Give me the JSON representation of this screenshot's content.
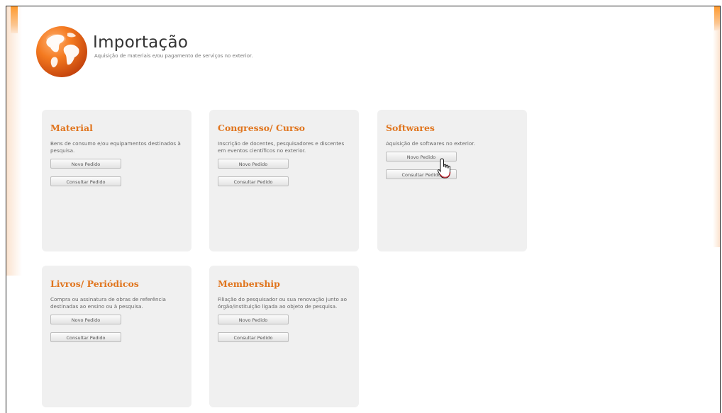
{
  "header": {
    "title": "Importação",
    "subtitle": "Aquisição de materiais e/ou pagamento de serviços no exterior."
  },
  "cards": [
    {
      "title": "Material",
      "description": "Bens de consumo e/ou equipamentos destinados à pesquisa.",
      "new_label": "Novo Pedido",
      "consult_label": "Consultar Pedido"
    },
    {
      "title": "Congresso/ Curso",
      "description": "Inscrição de docentes, pesquisadores e discentes em eventos científicos no exterior.",
      "new_label": "Novo Pedido",
      "consult_label": "Consultar Pedido"
    },
    {
      "title": "Softwares",
      "description": "Aquisição de softwares no exterior.",
      "new_label": "Novo Pedido",
      "consult_label": "Consultar Pedido"
    },
    {
      "title": "Livros/ Periódicos",
      "description": "Compra ou assinatura de obras de referência destinadas ao ensino ou à pesquisa.",
      "new_label": "Novo Pedido",
      "consult_label": "Consultar Pedido"
    },
    {
      "title": "Membership",
      "description": "Filiação do pesquisador ou sua renovação junto ao órgão/instituição ligada ao objeto de pesquisa.",
      "new_label": "Novo Pedido",
      "consult_label": "Consultar Pedido"
    }
  ],
  "colors": {
    "accent": "#e0751e",
    "card_bg": "#f0f0f0"
  },
  "icons": {
    "logo": "globe-icon",
    "cursor": "hand-pointer-icon"
  }
}
